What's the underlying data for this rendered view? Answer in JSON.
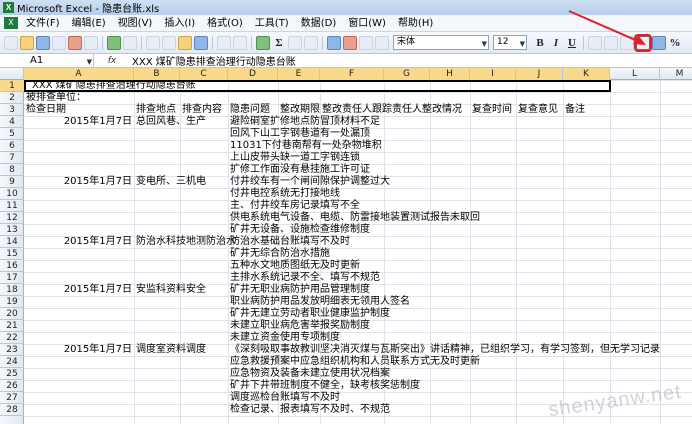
{
  "window": {
    "title": "Microsoft Excel - 隐患台账.xls",
    "app_icon": "X"
  },
  "menu": [
    "文件(F)",
    "编辑(E)",
    "视图(V)",
    "插入(I)",
    "格式(O)",
    "工具(T)",
    "数据(D)",
    "窗口(W)",
    "帮助(H)"
  ],
  "toolbar": {
    "font_name": "宋体",
    "font_size": "12",
    "bold": "B",
    "italic": "I",
    "underline": "U",
    "percent": "%"
  },
  "formula_bar": {
    "cell_ref": "A1",
    "fx": "fx",
    "content": "XXX 煤矿隐患排查治理行动隐患台账"
  },
  "columns": [
    "A",
    "B",
    "C",
    "D",
    "E",
    "F",
    "G",
    "H",
    "I",
    "J",
    "K",
    "L",
    "M"
  ],
  "rows": [
    "1",
    "2",
    "3",
    "4",
    "5",
    "6",
    "7",
    "8",
    "9",
    "10",
    "11",
    "12",
    "13",
    "14",
    "15",
    "16",
    "17",
    "18",
    "19",
    "20",
    "21",
    "22",
    "23",
    "24",
    "25",
    "26",
    "27",
    "28"
  ],
  "sheet": {
    "r1": "XXX 煤矿隐患排查治理行动隐患台账",
    "r2": "被排查单位：",
    "headers": [
      "检查日期",
      "排查地点",
      "排查内容",
      "隐患问题",
      "整改期限",
      "整改责任人",
      "跟踪责任人",
      "整改情况",
      "复查时间",
      "复查意见",
      "备注"
    ],
    "dates": [
      "2015年1月7日",
      "2015年1月7日",
      "2015年1月7日",
      "2015年1月7日",
      "2015年1月7日"
    ],
    "locations": [
      "总回风巷、生产",
      "变电所、三机电",
      "防治水科技地测防治水",
      "安监科资料安全",
      "调度室资料调度"
    ],
    "issues": [
      "避险硐室扩修地点防冒顶材料不足",
      "回风下山工字钢巷道有一处漏顶",
      "11031下付巷南帮有一处杂物堆积",
      "上山皮带头缺一道工字钢连锁",
      "扩修工作面没有悬挂施工许可证",
      "付井绞车有一个闸间隙保护调整过大",
      "付井电控系统无打接地线",
      "主、付井绞车房记录填写不全",
      "供电系统电气设备、电缆、防雷接地装置测试报告未取回",
      "矿井无设备、设施检查维修制度",
      "防治水基础台账填写不及时",
      "矿井无综合防治水措施",
      "五种水文地质图纸无及时更新",
      "主排水系统记录不全、填写不规范",
      "矿井无职业病防护用品管理制度",
      "职业病防护用品发放明细表无领用人签名",
      "矿井无建立劳动者职业健康监护制度",
      "未建立职业病危害举报奖励制度",
      "未建立资金使用专项制度",
      "《深刻吸取事故教训坚决消灭煤与瓦斯突出》讲话精神，已组织学习，有学习签到，但无学习记录",
      "应急救援预案中应急组织机构和人员联系方式无及时更新",
      "应急物资及装备未建立使用状况档案",
      "矿井下井带班制度不健全，缺考核奖惩制度",
      "调度巡检台账填写不及时",
      "检查记录、报表填写不及时、不规范"
    ]
  },
  "watermark": "shenyanw.net",
  "annotation": {
    "arrow_color": "#e0202a",
    "highlight": "merge-and-center-button"
  }
}
